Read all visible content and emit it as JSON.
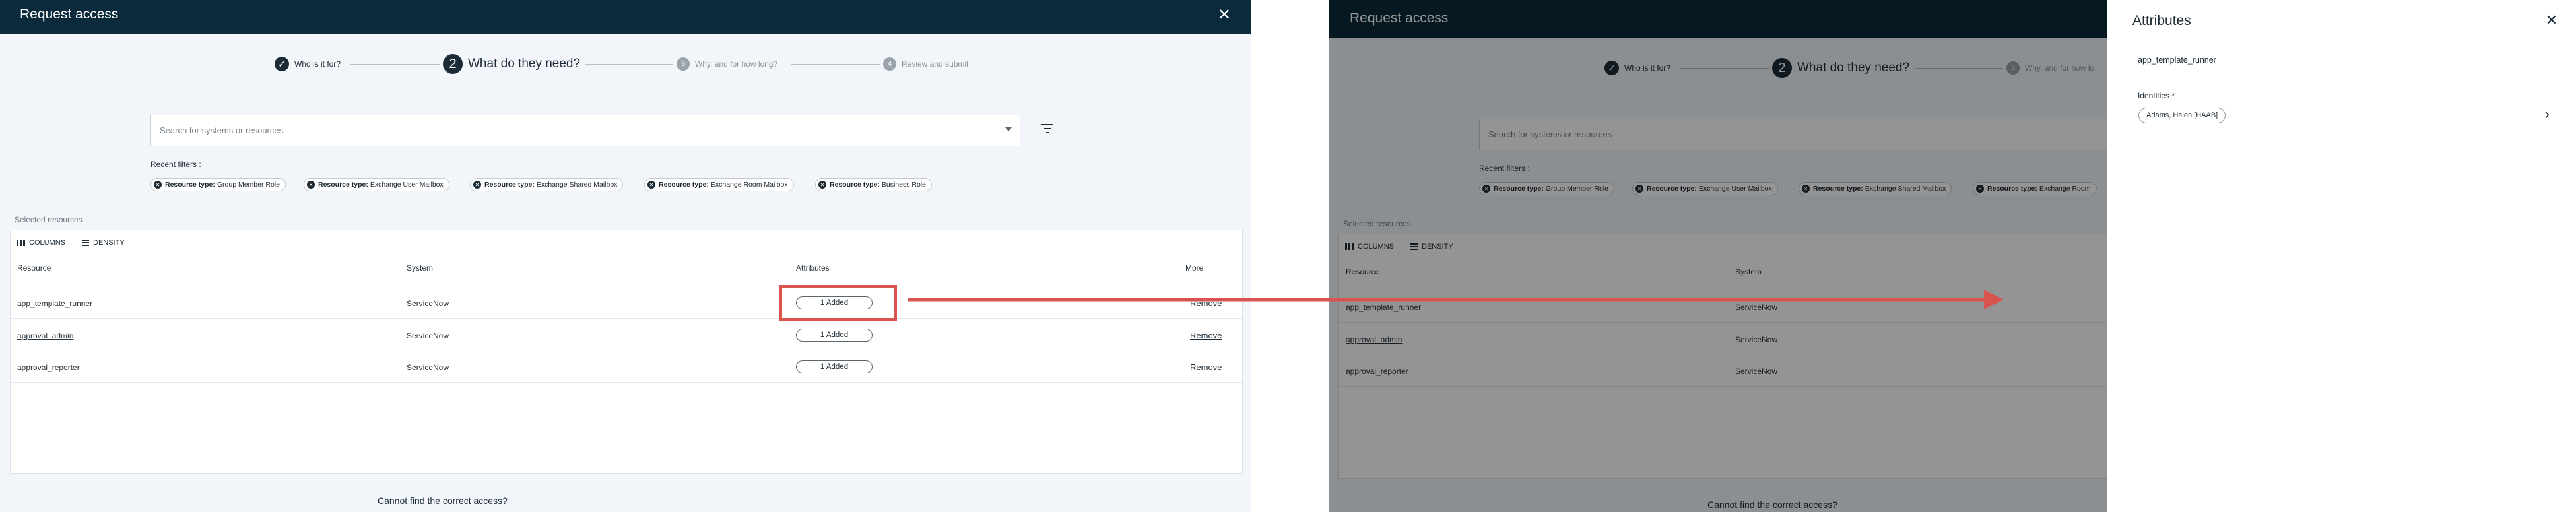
{
  "left": {
    "header": {
      "title": "Request access",
      "close_icon": "close-icon"
    },
    "steps": [
      {
        "num": "✓",
        "label": "Who is it for?",
        "state": "done"
      },
      {
        "num": "2",
        "label": "What do they need?",
        "state": "current"
      },
      {
        "num": "3",
        "label": "Why, and for how long?",
        "state": "upcoming"
      },
      {
        "num": "4",
        "label": "Review and submit",
        "state": "upcoming"
      }
    ],
    "search": {
      "placeholder": "Search for systems or resources"
    },
    "recent_filters_label": "Recent filters :",
    "chips": [
      {
        "key": "Resource type:",
        "value": "Group Member Role"
      },
      {
        "key": "Resource type:",
        "value": "Exchange User Mailbox"
      },
      {
        "key": "Resource type:",
        "value": "Exchange Shared Mailbox"
      },
      {
        "key": "Resource type:",
        "value": "Exchange Room Mailbox"
      },
      {
        "key": "Resource type:",
        "value": "Business Role"
      }
    ],
    "selected_label": "Selected resources",
    "toolbar": {
      "columns": "COLUMNS",
      "density": "DENSITY"
    },
    "columns": {
      "resource": "Resource",
      "system": "System",
      "attributes": "Attributes",
      "more": "More"
    },
    "rows": [
      {
        "resource": "app_template_runner",
        "system": "ServiceNow",
        "attributes": "1 Added",
        "action": "Remove"
      },
      {
        "resource": "approval_admin",
        "system": "ServiceNow",
        "attributes": "1 Added",
        "action": "Remove"
      },
      {
        "resource": "approval_reporter",
        "system": "ServiceNow",
        "attributes": "1 Added",
        "action": "Remove"
      }
    ],
    "footer_link": "Cannot find the correct access?"
  },
  "right": {
    "header": {
      "title": "Request access"
    },
    "steps": [
      {
        "num": "✓",
        "label": "Who is it for?"
      },
      {
        "num": "2",
        "label": "What do they need?"
      },
      {
        "num": "3",
        "label": "Why, and for how lo"
      }
    ],
    "search": {
      "placeholder": "Search for systems or resources"
    },
    "recent_filters_label": "Recent filters :",
    "chips": [
      {
        "key": "Resource type:",
        "value": "Group Member Role"
      },
      {
        "key": "Resource type:",
        "value": "Exchange User Mailbox"
      },
      {
        "key": "Resource type:",
        "value": "Exchange Shared Mailbox"
      },
      {
        "key": "Resource type:",
        "value": "Exchange Room"
      }
    ],
    "selected_label": "Selected resources",
    "toolbar": {
      "columns": "COLUMNS",
      "density": "DENSITY"
    },
    "columns": {
      "resource": "Resource",
      "system": "System"
    },
    "rows": [
      {
        "resource": "app_template_runner",
        "system": "ServiceNow"
      },
      {
        "resource": "approval_admin",
        "system": "ServiceNow"
      },
      {
        "resource": "approval_reporter",
        "system": "ServiceNow"
      }
    ],
    "footer_link": "Cannot find the correct access?",
    "panel": {
      "title": "Attributes",
      "resource": "app_template_runner",
      "identities_label": "Identities *",
      "identity_chip": "Adams, Helen [HAAB]"
    }
  },
  "colors": {
    "header": "#0b2a3c",
    "highlight": "#d9534f",
    "overlay": "rgba(0,0,0,0.42)"
  }
}
